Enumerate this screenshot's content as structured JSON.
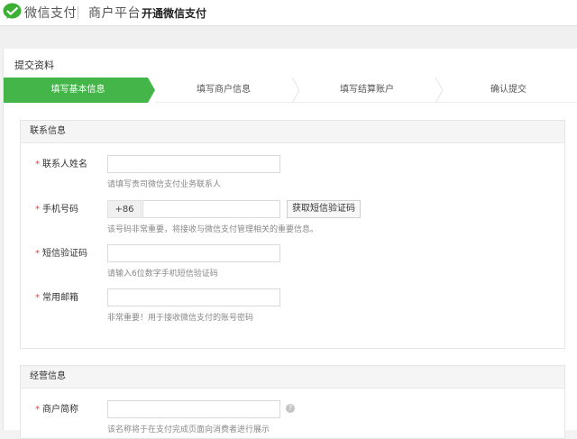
{
  "header": {
    "brand": "微信支付",
    "platform": "商户平台",
    "page_name": "开通微信支付"
  },
  "panel": {
    "title": "提交资料",
    "steps": [
      {
        "label": "填写基本信息",
        "active": true
      },
      {
        "label": "填写商户信息",
        "active": false
      },
      {
        "label": "填写结算账户",
        "active": false
      },
      {
        "label": "确认提交",
        "active": false
      }
    ]
  },
  "contact": {
    "title": "联系信息",
    "name": {
      "label": "联系人姓名",
      "value": "",
      "hint": "请填写贵司微信支付业务联系人"
    },
    "phone": {
      "label": "手机号码",
      "prefix": "+86",
      "value": "",
      "button": "获取短信验证码",
      "hint": "该号码非常重要，将接收与微信支付管理相关的重要信息。"
    },
    "sms": {
      "label": "短信验证码",
      "value": "",
      "hint": "请输入6位数字手机短信验证码"
    },
    "email": {
      "label": "常用邮箱",
      "value": "",
      "hint": "非常重要！用于接收微信支付的账号密码"
    }
  },
  "business": {
    "title": "经营信息",
    "short_name": {
      "label": "商户简称",
      "value": "",
      "hint": "该名称将于在支付完成页面向消费者进行展示"
    }
  },
  "colors": {
    "accent": "#44b549",
    "required": "#e64340"
  },
  "required_mark": "*"
}
